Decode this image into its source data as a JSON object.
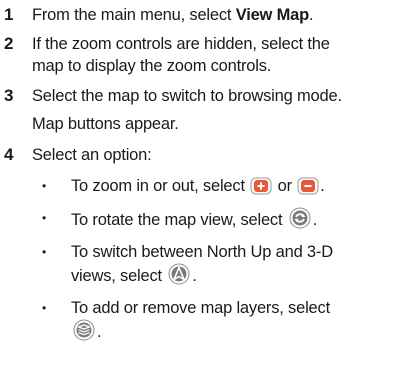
{
  "steps": [
    {
      "num": "1",
      "text_before": "From the main menu, select ",
      "text_bold": "View Map",
      "text_after": "."
    },
    {
      "num": "2",
      "line1": "If the zoom controls are hidden, select the",
      "line2": "map to display the zoom controls."
    },
    {
      "num": "3",
      "line1": "Select the map to switch to browsing mode.",
      "line2": "Map buttons appear."
    },
    {
      "num": "4",
      "line1": "Select an option:"
    }
  ],
  "bullets": {
    "b1_before": "To zoom in or out, select ",
    "b1_mid": " or ",
    "b1_end": ".",
    "b2_before": "To rotate the map view, select ",
    "b2_end": ".",
    "b3_line1": "To switch between North Up and 3-D",
    "b3_line2_before": "views, select ",
    "b3_end": ".",
    "b4_line1": "To add or remove map layers, select",
    "b4_end": ".",
    "dot": "•"
  },
  "icons": {
    "zoom_in": "zoom-in-icon",
    "zoom_out": "zoom-out-icon",
    "rotate": "rotate-icon",
    "north_up": "north-up-icon",
    "layers": "layers-icon"
  },
  "colors": {
    "icon_fill": "#7a7a7a",
    "zoom_fill": "#e8593a",
    "text": "#1a1a1a"
  }
}
